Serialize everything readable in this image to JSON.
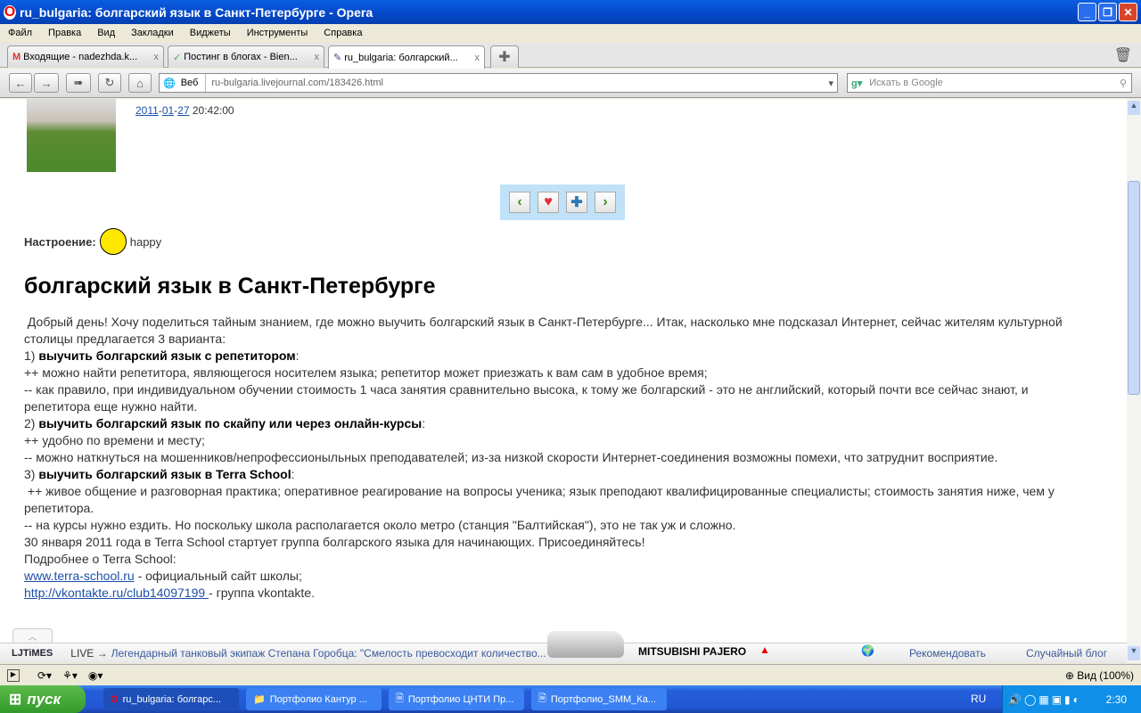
{
  "window": {
    "title": "ru_bulgaria: болгарский язык в Санкт-Петербурге - Opera"
  },
  "menu": [
    "Файл",
    "Правка",
    "Вид",
    "Закладки",
    "Виджеты",
    "Инструменты",
    "Справка"
  ],
  "tabs": [
    {
      "label": "Входящие - nadezhda.k...",
      "icon": "gmail-icon"
    },
    {
      "label": "Постинг в блогах - Bien...",
      "icon": "leaf-icon"
    },
    {
      "label": "ru_bulgaria: болгарский...",
      "icon": "pencil-icon",
      "active": true
    }
  ],
  "toolbar": {
    "web_label": "Веб",
    "url": "ru-bulgaria.livejournal.com/183426.html",
    "search_placeholder": "Искать в Google"
  },
  "post": {
    "date_year": "2011",
    "date_month": "01",
    "date_day": "27",
    "time": "20:42:00",
    "mood_label": "Настроение:",
    "mood": "happy",
    "title": "болгарский язык в Санкт-Петербурге",
    "lines": [
      {
        "text": " Добрый день! Хочу поделиться тайным знанием, где можно выучить болгарский язык в Санкт-Петербурге... Итак, насколько мне подсказал Интернет, сейчас жителям культурной столицы предлагается 3 варианта:"
      },
      {
        "pre": "1) ",
        "bold": "выучить болгарский язык с репетитором",
        "post": ":"
      },
      {
        "text": "++ можно найти репетитора, являющегося носителем языка; репетитор может приезжать к вам сам в удобное время;"
      },
      {
        "text": "-- как правило, при индивидуальном обучении стоимость 1 часа занятия сравнительно высока, к тому же болгарский - это не английский, который почти все сейчас знают, и репетитора еще нужно найти."
      },
      {
        "pre": "2) ",
        "bold": "выучить болгарский язык по скайпу или через онлайн-курсы",
        "post": ":"
      },
      {
        "text": "++ удобно по времени и месту;"
      },
      {
        "text": "-- можно наткнуться на мошенников/непрофессионыльных преподавателей; из-за низкой скорости Интернет-соединения возможны помехи, что затруднит восприятие."
      },
      {
        "pre": "3) ",
        "bold": "выучить болгарский язык в Terra School",
        "post": ":"
      },
      {
        "text": " ++ живое общение и разговорная практика; оперативное реагирование на вопросы ученика; язык преподают квалифицированные специалисты; стоимость занятия ниже, чем у репетитора."
      },
      {
        "text": "-- на курсы нужно ездить. Но поскольку школа располагается около метро (станция \"Балтийская\"), это не так уж и сложно."
      },
      {
        "text": "30 января 2011 года в Terra School стартует группа болгарского языка для начинающих. Присоединяйтесь!"
      },
      {
        "text": "Подробнее о Terra School:"
      }
    ],
    "links": [
      {
        "url": "www.terra-school.ru",
        "desc": " - официальный сайт школы;"
      },
      {
        "url": "http://vkontakte.ru/club14097199 ",
        "desc": " - группа vkontakte."
      }
    ]
  },
  "ljtimes": {
    "logo": "LJTiMES",
    "live": "LIVE →",
    "headline": "Легендарный танковый экипаж Степана Горобца: \"Смелость превосходит количество...",
    "ad": "MITSUBISHI PAJERO",
    "recommend": "Рекомендовать",
    "random": "Случайный блог"
  },
  "status": {
    "zoom": "Вид (100%)"
  },
  "taskbar": {
    "start": "пуск",
    "tasks": [
      "ru_bulgaria: болгарс...",
      "Портфолио Кантур ...",
      "Портфолио ЦНТИ Пр...",
      "Портфолио_SMM_Ка..."
    ],
    "lang": "RU",
    "clock": "2:30"
  }
}
